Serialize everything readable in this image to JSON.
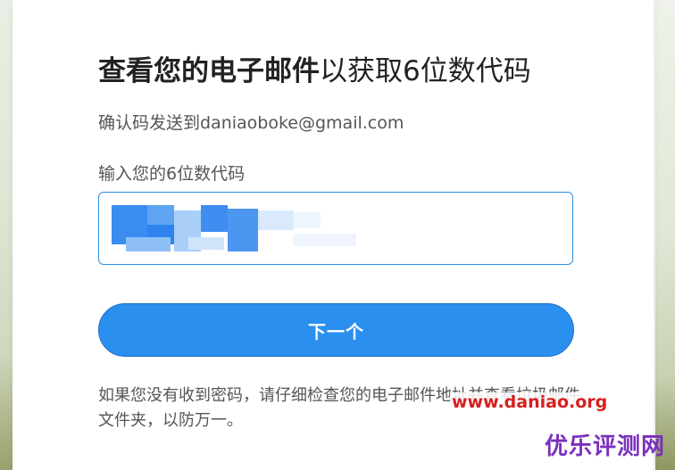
{
  "dialog": {
    "title_bold": "查看您的电子邮件",
    "title_rest": "以获取6位数代码",
    "sent_to_text": "确认码发送到daniaoboke@gmail.com",
    "code_label": "输入您的6位数代码",
    "code_value": "",
    "next_button_label": "下一个",
    "hint_text": "如果您没有收到密码，请仔细检查您的电子邮件地址并查看垃圾邮件文件夹，以防万一。"
  },
  "watermarks": {
    "url": "www.daniao.org",
    "site_name": "优乐评测网"
  },
  "colors": {
    "accent": "#2b8ff0",
    "input_border": "#2b8fe3",
    "watermark_red": "#d81e1e",
    "watermark_purple": "#7a2fbd"
  }
}
